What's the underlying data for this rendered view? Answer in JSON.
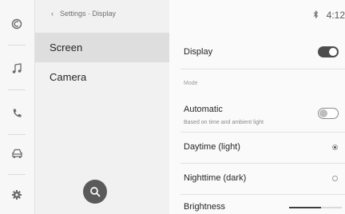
{
  "rail": {
    "icons": [
      "home-icon",
      "music-icon",
      "phone-icon",
      "car-icon",
      "settings-icon"
    ]
  },
  "menu": {
    "breadcrumb_back_glyph": "‹",
    "breadcrumb": "Settings · Display",
    "items": [
      {
        "label": "Screen",
        "selected": true
      },
      {
        "label": "Camera",
        "selected": false
      }
    ],
    "search_icon": "search-icon"
  },
  "status": {
    "bluetooth_icon": "bluetooth-icon",
    "time": "4:12"
  },
  "detail": {
    "display": {
      "label": "Display",
      "enabled": true
    },
    "mode_section": "Mode",
    "automatic": {
      "label": "Automatic",
      "sublabel": "Based on time and ambient light",
      "enabled": false
    },
    "options": [
      {
        "label": "Daytime (light)",
        "selected": true
      },
      {
        "label": "Nighttime (dark)",
        "selected": false
      }
    ],
    "brightness": {
      "label": "Brightness",
      "level": 0.6
    }
  },
  "colors": {
    "toggle_on": "#4d4d4d",
    "fab": "#5a5a5a",
    "selected_row": "#dedede"
  }
}
